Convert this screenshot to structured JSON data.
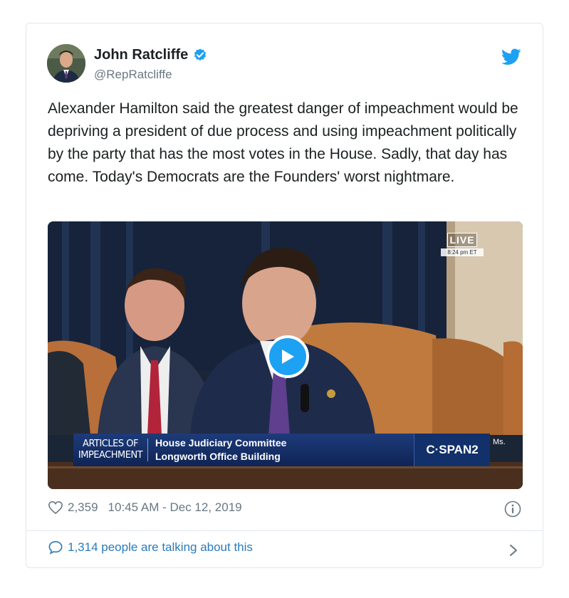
{
  "tweet": {
    "author_name": "John Ratcliffe",
    "author_handle": "@RepRatcliffe",
    "text": "Alexander Hamilton said the greatest danger of impeachment would be depriving a president of due process and using impeachment politically by the party that has the most votes in the House. Sadly, that day has come. Today's Democrats are the Founders' worst nightmare.",
    "likes": "2,359",
    "timestamp": "10:45 AM - Dec 12, 2019",
    "talking": "1,314 people are talking about this"
  },
  "video": {
    "live_label": "LIVE",
    "live_time": "8:24 pm ET",
    "chyron_left": "ARTICLES OF IMPEACHMENT",
    "chyron_line1": "House Judiciary Committee",
    "chyron_line2": "Longworth Office Building",
    "network": "C·SPAN2",
    "corner_text": "Ms."
  },
  "colors": {
    "twitter_blue": "#1da1f2",
    "link_blue": "#2b7bb9",
    "muted_gray": "#697882",
    "cspan_navy": "#0f2455"
  },
  "icons": [
    "verified-badge-icon",
    "twitter-bird-icon",
    "play-icon",
    "heart-icon",
    "info-icon",
    "speech-bubble-icon",
    "chevron-right-icon"
  ]
}
